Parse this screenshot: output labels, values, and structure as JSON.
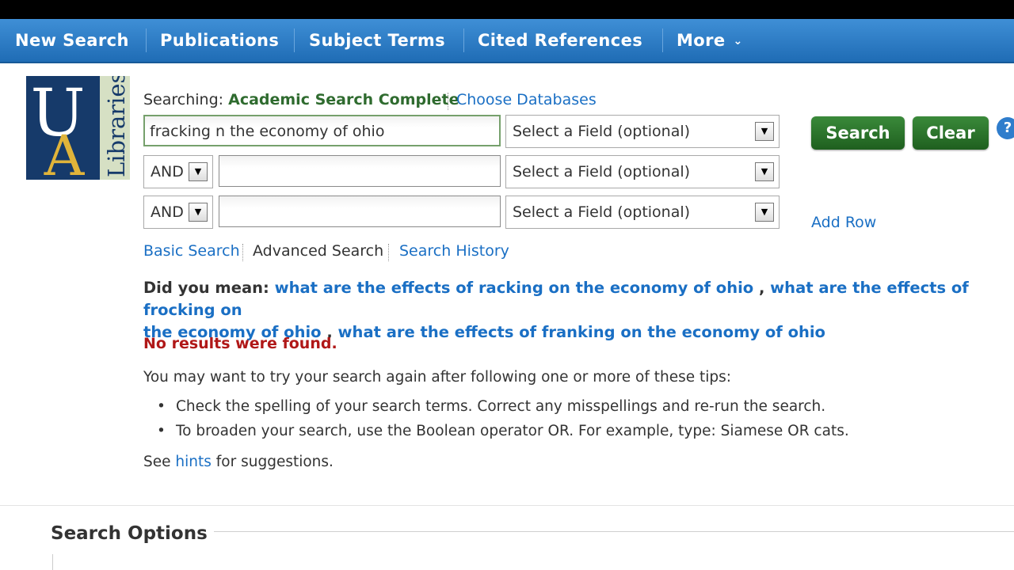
{
  "nav": {
    "items": [
      "New Search",
      "Publications",
      "Subject Terms",
      "Cited References",
      "More"
    ]
  },
  "logo": {
    "letters_top": "U",
    "letters_bottom": "A",
    "text": "Libraries"
  },
  "searching": {
    "label": "Searching:",
    "database": "Academic Search Complete",
    "choose": "Choose Databases"
  },
  "rows": [
    {
      "query": "fracking n the economy of ohio",
      "field": "Select a Field (optional)"
    },
    {
      "operator": "AND",
      "query": "",
      "field": "Select a Field (optional)"
    },
    {
      "operator": "AND",
      "query": "",
      "field": "Select a Field (optional)"
    }
  ],
  "buttons": {
    "search": "Search",
    "clear": "Clear",
    "help": "?",
    "add_row": "Add Row"
  },
  "modes": {
    "basic": "Basic Search",
    "advanced": "Advanced Search",
    "history": "Search History"
  },
  "did_you_mean": {
    "label": "Did you mean:",
    "s1": "what are the effects of racking on the economy of ohio",
    "sep1": ",",
    "s2a": "what are the effects of frocking on",
    "s2b": "the economy of ohio",
    "sep2": ",",
    "s3": "what are the effects of franking on the economy of ohio"
  },
  "no_results": "No results were found.",
  "tips": {
    "intro": "You may want to try your search again after following one or more of these tips:",
    "items": [
      "Check the spelling of your search terms. Correct any misspellings and re-run the search.",
      "To broaden your search, use the Boolean operator OR. For example, type: Siamese OR cats."
    ]
  },
  "hints": {
    "pre": "See",
    "link": "hints",
    "post": "for suggestions."
  },
  "search_options": {
    "title": "Search Options"
  },
  "colors": {
    "nav_blue": "#2a7cc8",
    "button_green": "#2e7a2e",
    "link": "#1a6fc4",
    "error": "#b01818"
  }
}
